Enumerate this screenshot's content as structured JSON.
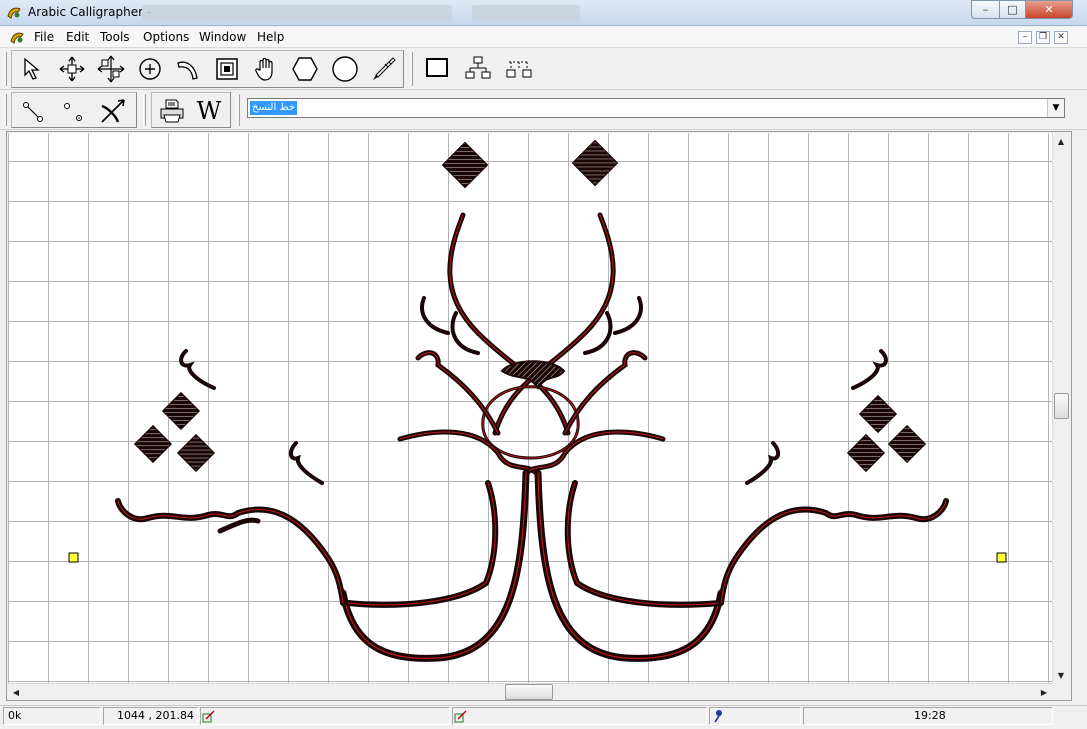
{
  "window": {
    "title": "Arabic Calligrapher -",
    "controls": {
      "minimize": "–",
      "maximize": "□",
      "close": "✕"
    }
  },
  "menubar": {
    "items": [
      "File",
      "Edit",
      "Tools",
      "Options",
      "Window",
      "Help"
    ],
    "mdi_controls": {
      "minimize": "–",
      "restore": "❐",
      "close": "✕"
    }
  },
  "toolbar_top": {
    "icons": [
      "select-arrow-icon",
      "move-icon",
      "resize-icon",
      "target-icon",
      "curve-icon",
      "frame-icon",
      "hand-icon",
      "hexagon-icon",
      "circle-icon",
      "pen-icon",
      "rectangle-icon",
      "tree-icon",
      "tree-dotted-icon"
    ]
  },
  "toolbar_bottom": {
    "icons": [
      "node-icon",
      "node-pair-icon",
      "bow-arrow-icon",
      "printer-icon",
      "word-icon"
    ],
    "word_glyph": "W",
    "script_select": {
      "value": "خط النسخ",
      "arrow": "▼"
    }
  },
  "canvas": {
    "description_icon": "calligraphy-drawing",
    "stroke_color": "#1a0606",
    "accent_color": "#c21818",
    "handle_color": "#ffff33"
  },
  "scrollbars": {
    "up": "▲",
    "down": "▼",
    "left": "◀",
    "right": "▶"
  },
  "statusbar": {
    "status": "0k",
    "coordinates": "1044 , 201.84",
    "time": "19:28"
  }
}
